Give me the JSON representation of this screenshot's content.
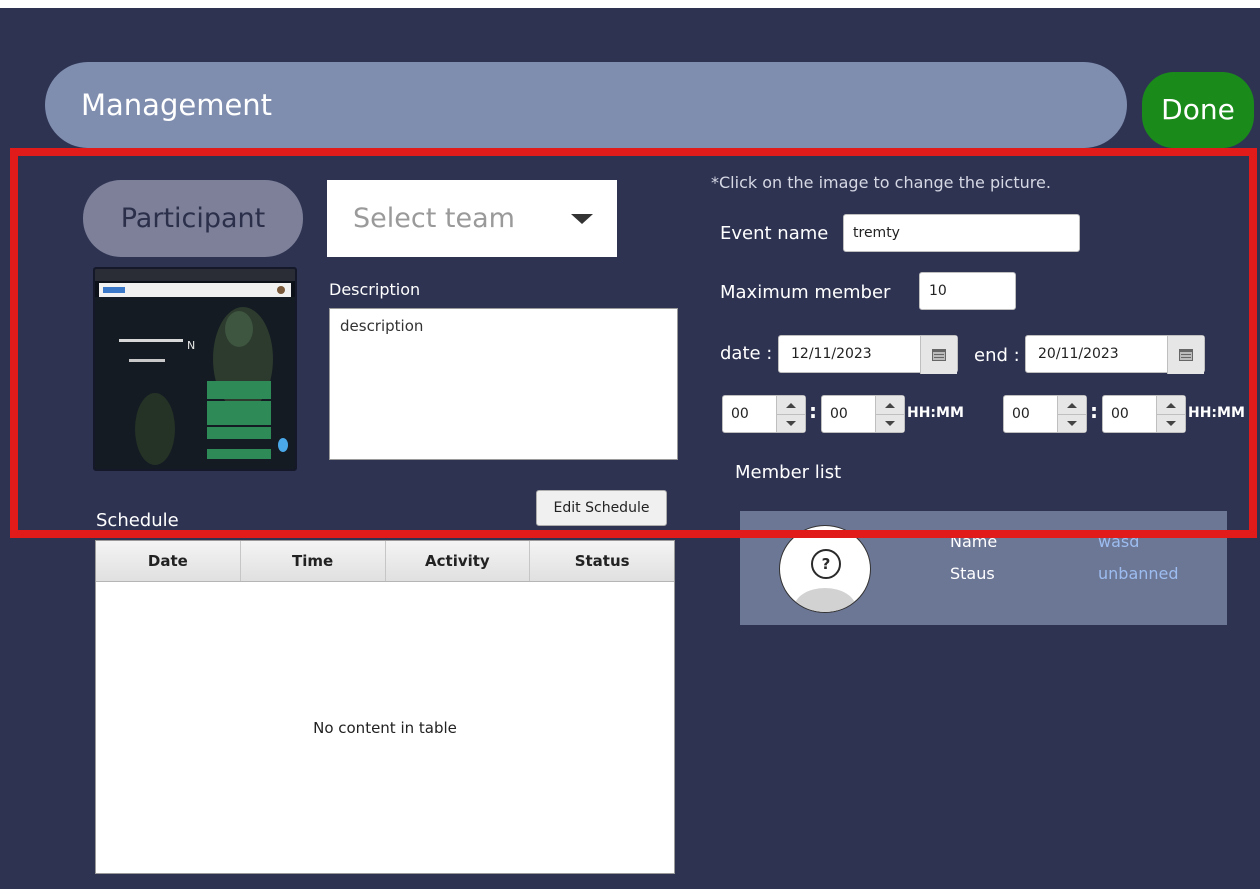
{
  "header": {
    "title": "Management",
    "done_label": "Done"
  },
  "left": {
    "participant_label": "Participant",
    "team_select": {
      "placeholder": "Select team"
    },
    "description_label": "Description",
    "description_value": "description"
  },
  "right": {
    "hint": "*Click on the image to change the picture.",
    "event_name_label": "Event name",
    "event_name_value": "tremty",
    "max_member_label": "Maximum  member",
    "max_member_value": "10",
    "date_label": "date :",
    "start_date": "12/11/2023",
    "end_label": "end :",
    "end_date": "20/11/2023",
    "start_time": {
      "hours": "00",
      "minutes": "00",
      "format": "HH:MM"
    },
    "end_time": {
      "hours": "00",
      "minutes": "00",
      "format": "HH:MM"
    },
    "member_list_label": "Member list",
    "member": {
      "name_key": "Name",
      "name_value": "wasd",
      "status_key": "Staus",
      "status_value": "unbanned"
    }
  },
  "schedule": {
    "label": "Schedule",
    "edit_label": "Edit Schedule",
    "columns": [
      "Date",
      "Time",
      "Activity",
      "Status"
    ],
    "empty_message": "No content in table"
  },
  "icons": {
    "dropdown": "caret-down-icon",
    "calendar": "calendar-icon",
    "avatar": "user-placeholder-icon"
  },
  "colors": {
    "background": "#2e3352",
    "title_bar": "#7f8daf",
    "done_button": "#1a8b1a",
    "participant_button": "#7d8098",
    "member_card": "#6c7695",
    "highlight": "#e11a1a",
    "member_value": "#9dbdf0"
  }
}
